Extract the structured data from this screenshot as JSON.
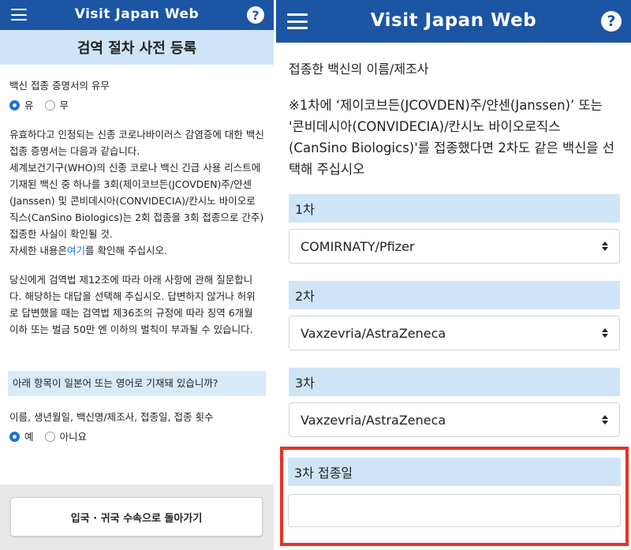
{
  "left": {
    "app_title": "Visit Japan Web",
    "help_icon": "?",
    "section_title": "검역 절차 사전 등록",
    "vaccine_cert_question": "백신 접종 증명서의 유무",
    "radio_yes": "유",
    "radio_no": "무",
    "para1_line1": "유효하다고 인정되는 신종 코로나바이러스 감염증에 대한 백신 접종 증명서는 다음과 같습니다.",
    "para1_line2": "세계보건기구(WHO)의 신종 코로나 백신 긴급 사용 리스트에 기재된 백신 중 하나를 3회(제이코브든(JCOVDEN)주/얀센(Janssen) 및 콘비데시아(CONVIDECIA)/칸시노 바이오로직스(CanSino Biologics)는 2회 접종을 3회 접종으로 간주) 접종한 사실이 확인될 것.",
    "para1_line3_prefix": "자세한 내용은",
    "para1_link": "여기",
    "para1_line3_suffix": "를 확인해 주십시오.",
    "para2": "당신에게 검역법 제12조에 따라 아래 사항에 관해 질문합니다. 해당하는 대답을 선택해 주십시오. 답변하지 않거나 허위로 답변했을 때는 검역법 제36조의 규정에 따라 징역 6개월 이하 또는 벌금 50만 엔 이하의 벌칙이 부과될 수 있습니다.",
    "language_question": "아래 항목이 일본어 또는 영어로 기재돼 있습니까?",
    "items_label": "이름, 생년월일, 백신명/제조사, 접종일, 접종 횟수",
    "radio2_yes": "예",
    "radio2_no": "아니요",
    "back_button": "입국 · 귀국 수속으로 돌아가기"
  },
  "right": {
    "app_title": "Visit Japan Web",
    "help_icon": "?",
    "vaccine_name_label": "접종한 백신의 이름/제조사",
    "note": "※1차에 ‘제이코브든(JCOVDEN)주/얀센(Janssen)’ 또는 '콘비데시아(CONVIDECIA)/칸시노 바이오로직스(CanSino Biologics)'를 접종했다면 2차도 같은 백신을 선택해 주십시오",
    "doses": [
      {
        "label": "1차",
        "value": "COMIRNATY/Pfizer"
      },
      {
        "label": "2차",
        "value": "Vaxzevria/AstraZeneca"
      },
      {
        "label": "3차",
        "value": "Vaxzevria/AstraZeneca"
      }
    ],
    "dose3_date_label": "3차 접종일",
    "dose3_date_value": ""
  },
  "colors": {
    "header_blue": "#1b55a3",
    "section_blue": "#cfe5f7",
    "radio_blue": "#1e6fd9",
    "highlight_red": "#e53422"
  }
}
